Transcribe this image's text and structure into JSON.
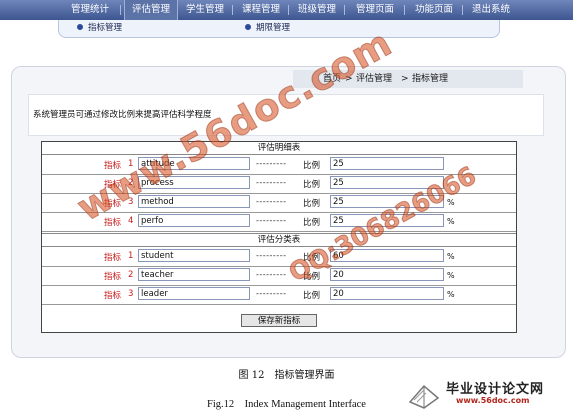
{
  "nav": {
    "items": [
      {
        "label": "管理统计",
        "active": false
      },
      {
        "label": "评估管理",
        "active": true
      },
      {
        "label": "学生管理",
        "active": false
      },
      {
        "label": "课程管理",
        "active": false
      },
      {
        "label": "班级管理",
        "active": false
      },
      {
        "label": "管理页面",
        "active": false
      },
      {
        "label": "功能页面",
        "active": false
      },
      {
        "label": "退出系统",
        "active": false
      }
    ]
  },
  "subnav": {
    "items": [
      {
        "label": "指标管理"
      },
      {
        "label": "期限管理"
      }
    ]
  },
  "breadcrumb": {
    "home": "首页",
    "sep": ">",
    "section": "评估管理",
    "current": "指标管理"
  },
  "notice": "系统管理员可通过修改比例来提高评估科学程度",
  "form": {
    "detail_header": "评估明细表",
    "category_header": "评估分类表",
    "indicator_label": "指标",
    "dashes": "---------",
    "ratio_label": "比例",
    "percent": "%",
    "detail_rows": [
      {
        "index": "1",
        "name": "attitude",
        "value": "25"
      },
      {
        "index": "2",
        "name": "process",
        "value": "25"
      },
      {
        "index": "3",
        "name": "method",
        "value": "25"
      },
      {
        "index": "4",
        "name": "perfo",
        "value": "25"
      }
    ],
    "category_rows": [
      {
        "index": "1",
        "name": "student",
        "value": "60"
      },
      {
        "index": "2",
        "name": "teacher",
        "value": "20"
      },
      {
        "index": "3",
        "name": "leader",
        "value": "20"
      }
    ],
    "save_button": "保存新指标"
  },
  "caption": {
    "zh": "图 12　指标管理界面",
    "en": "Fig.12　Index Management Interface"
  },
  "watermark": {
    "main": "www.56doc.com",
    "qq": "QQ:306826066",
    "logo_text": "毕业设计论文网",
    "logo_url": "www.56doc.com"
  }
}
